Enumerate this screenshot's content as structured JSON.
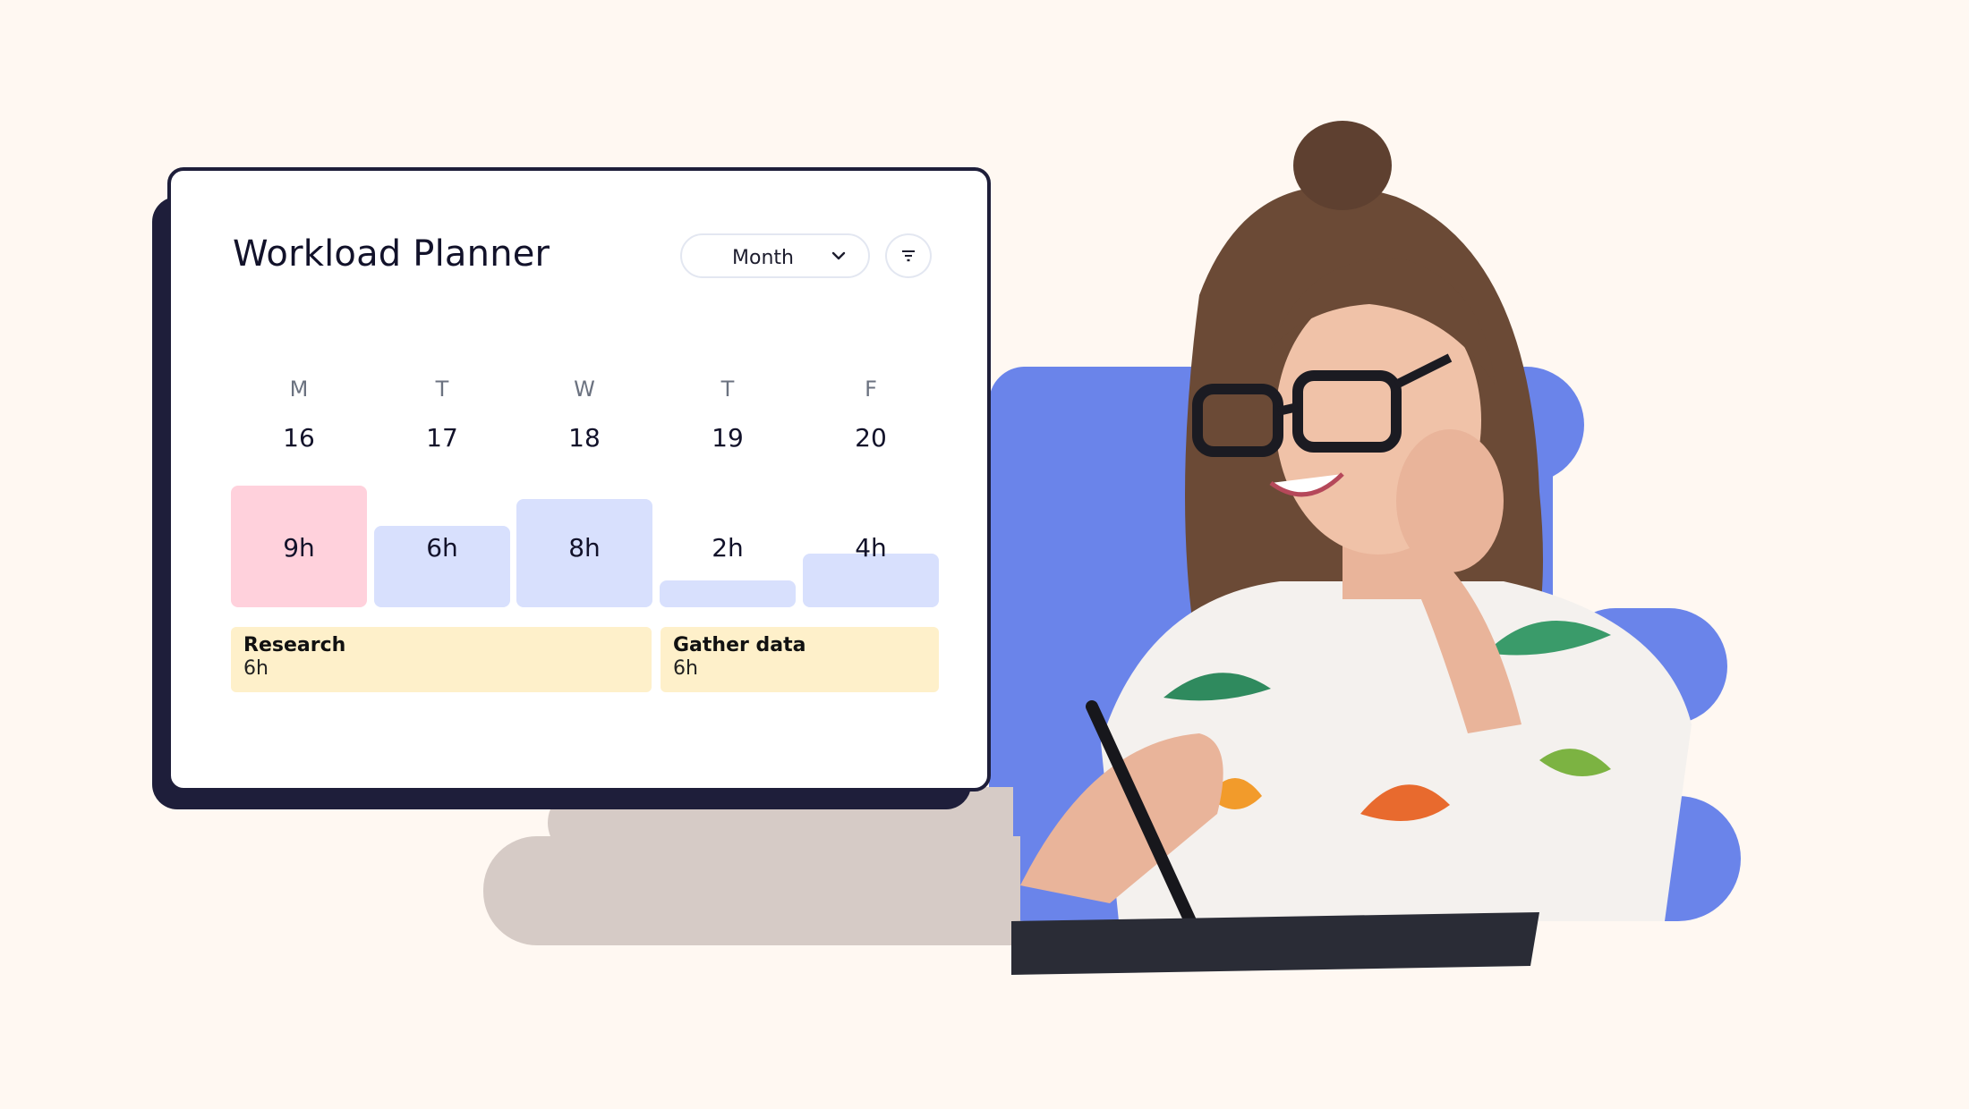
{
  "planner": {
    "title": "Workload Planner",
    "period_select": {
      "value": "Month",
      "icon": "chevron-down-icon"
    },
    "filter_button": {
      "icon": "filter-icon"
    },
    "days": [
      {
        "letter": "M",
        "date": "16",
        "hours": 9,
        "label": "9h",
        "status": "over"
      },
      {
        "letter": "T",
        "date": "17",
        "hours": 6,
        "label": "6h",
        "status": "normal"
      },
      {
        "letter": "W",
        "date": "18",
        "hours": 8,
        "label": "8h",
        "status": "normal"
      },
      {
        "letter": "T",
        "date": "19",
        "hours": 2,
        "label": "2h",
        "status": "normal"
      },
      {
        "letter": "F",
        "date": "20",
        "hours": 4,
        "label": "4h",
        "status": "normal"
      }
    ],
    "tasks": [
      {
        "name": "Research",
        "hours": "6h",
        "span_days": [
          0,
          2
        ]
      },
      {
        "name": "Gather data",
        "hours": "6h",
        "span_days": [
          3,
          4
        ]
      }
    ]
  },
  "colors": {
    "background": "#FFF8F2",
    "card_border": "#1E1E3A",
    "bar_over": "#FFD1DC",
    "bar_normal": "#D8E0FD",
    "task": "#FEF0CA",
    "accent_blob": "#6A84EA"
  }
}
